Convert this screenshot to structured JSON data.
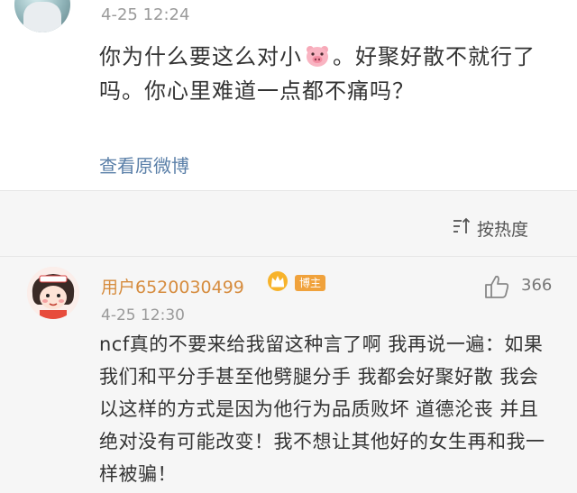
{
  "post": {
    "time": "4-25 12:24",
    "text_before_emoji": "你为什么要这么对小",
    "text_after_emoji": "。好聚好散不就行了吗。你心里难道一点都不痛吗？",
    "emoji": "pig-face-icon",
    "view_original": "查看原微博"
  },
  "sort": {
    "label": "按热度",
    "icon": "sort-icon"
  },
  "comment": {
    "username": "用户6520030499",
    "badge": "博主",
    "time": "4-25 12:30",
    "likes": "366",
    "text": "ncf真的不要来给我留这种言了啊 我再说一遍：如果我们和平分手甚至他劈腿分手 我都会好聚好散 我会以这样的方式是因为他行为品质败坏 道德沦丧 并且绝对没有可能改变！我不想让其他好的女生再和我一样被骗！"
  },
  "colors": {
    "username": "#d68c3e",
    "link": "#5a7fa8",
    "badge": "#f0a23c",
    "comments_bg": "#f6f6f6"
  }
}
